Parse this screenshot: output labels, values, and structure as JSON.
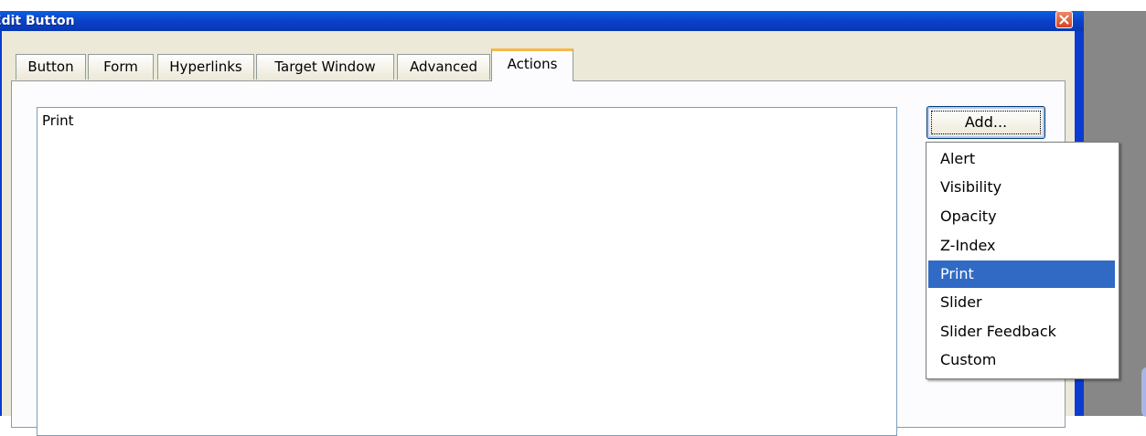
{
  "window": {
    "title": "Edit Button",
    "close_icon": "close-icon"
  },
  "tabs": [
    {
      "label": "Button"
    },
    {
      "label": "Form"
    },
    {
      "label": "Hyperlinks"
    },
    {
      "label": "Target Window"
    },
    {
      "label": "Advanced"
    },
    {
      "label": "Actions",
      "active": true
    }
  ],
  "actions": {
    "items": [
      "Print"
    ],
    "add_button_label": "Add..."
  },
  "add_menu": {
    "items": [
      {
        "label": "Alert"
      },
      {
        "label": "Visibility"
      },
      {
        "label": "Opacity"
      },
      {
        "label": "Z-Index"
      },
      {
        "label": "Print",
        "selected": true
      },
      {
        "label": "Slider"
      },
      {
        "label": "Slider Feedback"
      },
      {
        "label": "Custom"
      }
    ]
  },
  "colors": {
    "titlebar": "#0a47d6",
    "tab_active_accent": "#f7b848",
    "menu_selection": "#316ac5",
    "dialog_face": "#ece9d8"
  }
}
